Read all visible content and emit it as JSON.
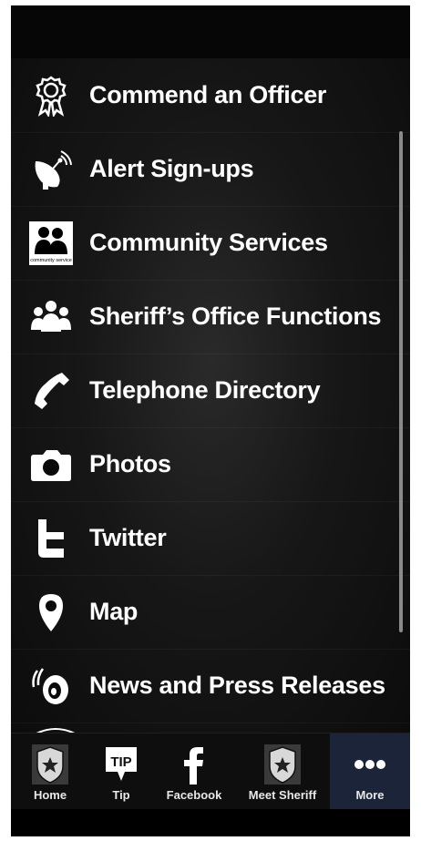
{
  "menu": {
    "items": [
      {
        "label": "Commend an Officer",
        "icon": "ribbon-award-icon"
      },
      {
        "label": "Alert Sign-ups",
        "icon": "satellite-dish-icon"
      },
      {
        "label": "Community Services",
        "icon": "community-service-icon"
      },
      {
        "label": "Sheriff’s Office Functions",
        "icon": "group-people-icon"
      },
      {
        "label": "Telephone Directory",
        "icon": "telephone-handset-icon"
      },
      {
        "label": "Photos",
        "icon": "camera-icon"
      },
      {
        "label": "Twitter",
        "icon": "twitter-icon"
      },
      {
        "label": "Map",
        "icon": "map-pin-icon"
      },
      {
        "label": "News and Press Releases",
        "icon": "news-podcast-icon"
      }
    ]
  },
  "tabbar": {
    "tabs": [
      {
        "label": "Home",
        "icon": "sheriff-badge-icon"
      },
      {
        "label": "Tip",
        "icon": "tip-speech-icon"
      },
      {
        "label": "Facebook",
        "icon": "facebook-icon"
      },
      {
        "label": "Meet Sheriff",
        "icon": "sheriff-badge-icon"
      },
      {
        "label": "More",
        "icon": "more-dots-icon"
      }
    ],
    "active": "More"
  },
  "colors": {
    "text": "#ffffff",
    "active_tab": "#1b2438",
    "background": "#0a0a0a"
  },
  "community_icon_caption": "community service"
}
